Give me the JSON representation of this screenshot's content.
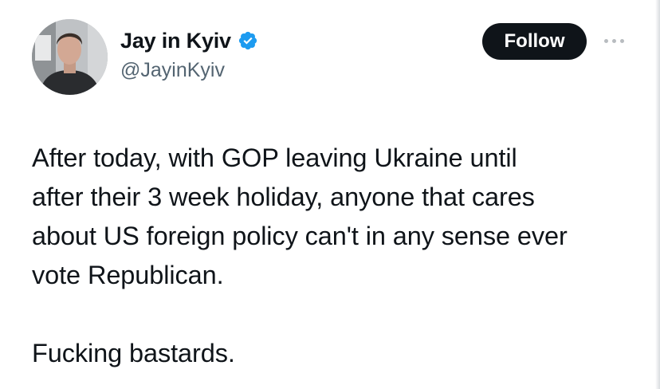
{
  "author": {
    "display_name": "Jay in Kyiv",
    "handle": "@JayinKyiv",
    "verified": true,
    "verified_badge_color": "#1d9bf0",
    "avatar_icon": "profile-photo"
  },
  "actions": {
    "follow_label": "Follow",
    "more_icon": "ellipsis-icon"
  },
  "tweet": {
    "text": "After today, with GOP leaving Ukraine until\nafter their 3 week holiday, anyone that cares\nabout US foreign policy can't in any sense ever\nvote Republican.\n\nFucking bastards."
  },
  "colors": {
    "text_primary": "#0f1419",
    "text_secondary": "#536471",
    "button_background": "#0f1419",
    "button_text": "#ffffff"
  }
}
